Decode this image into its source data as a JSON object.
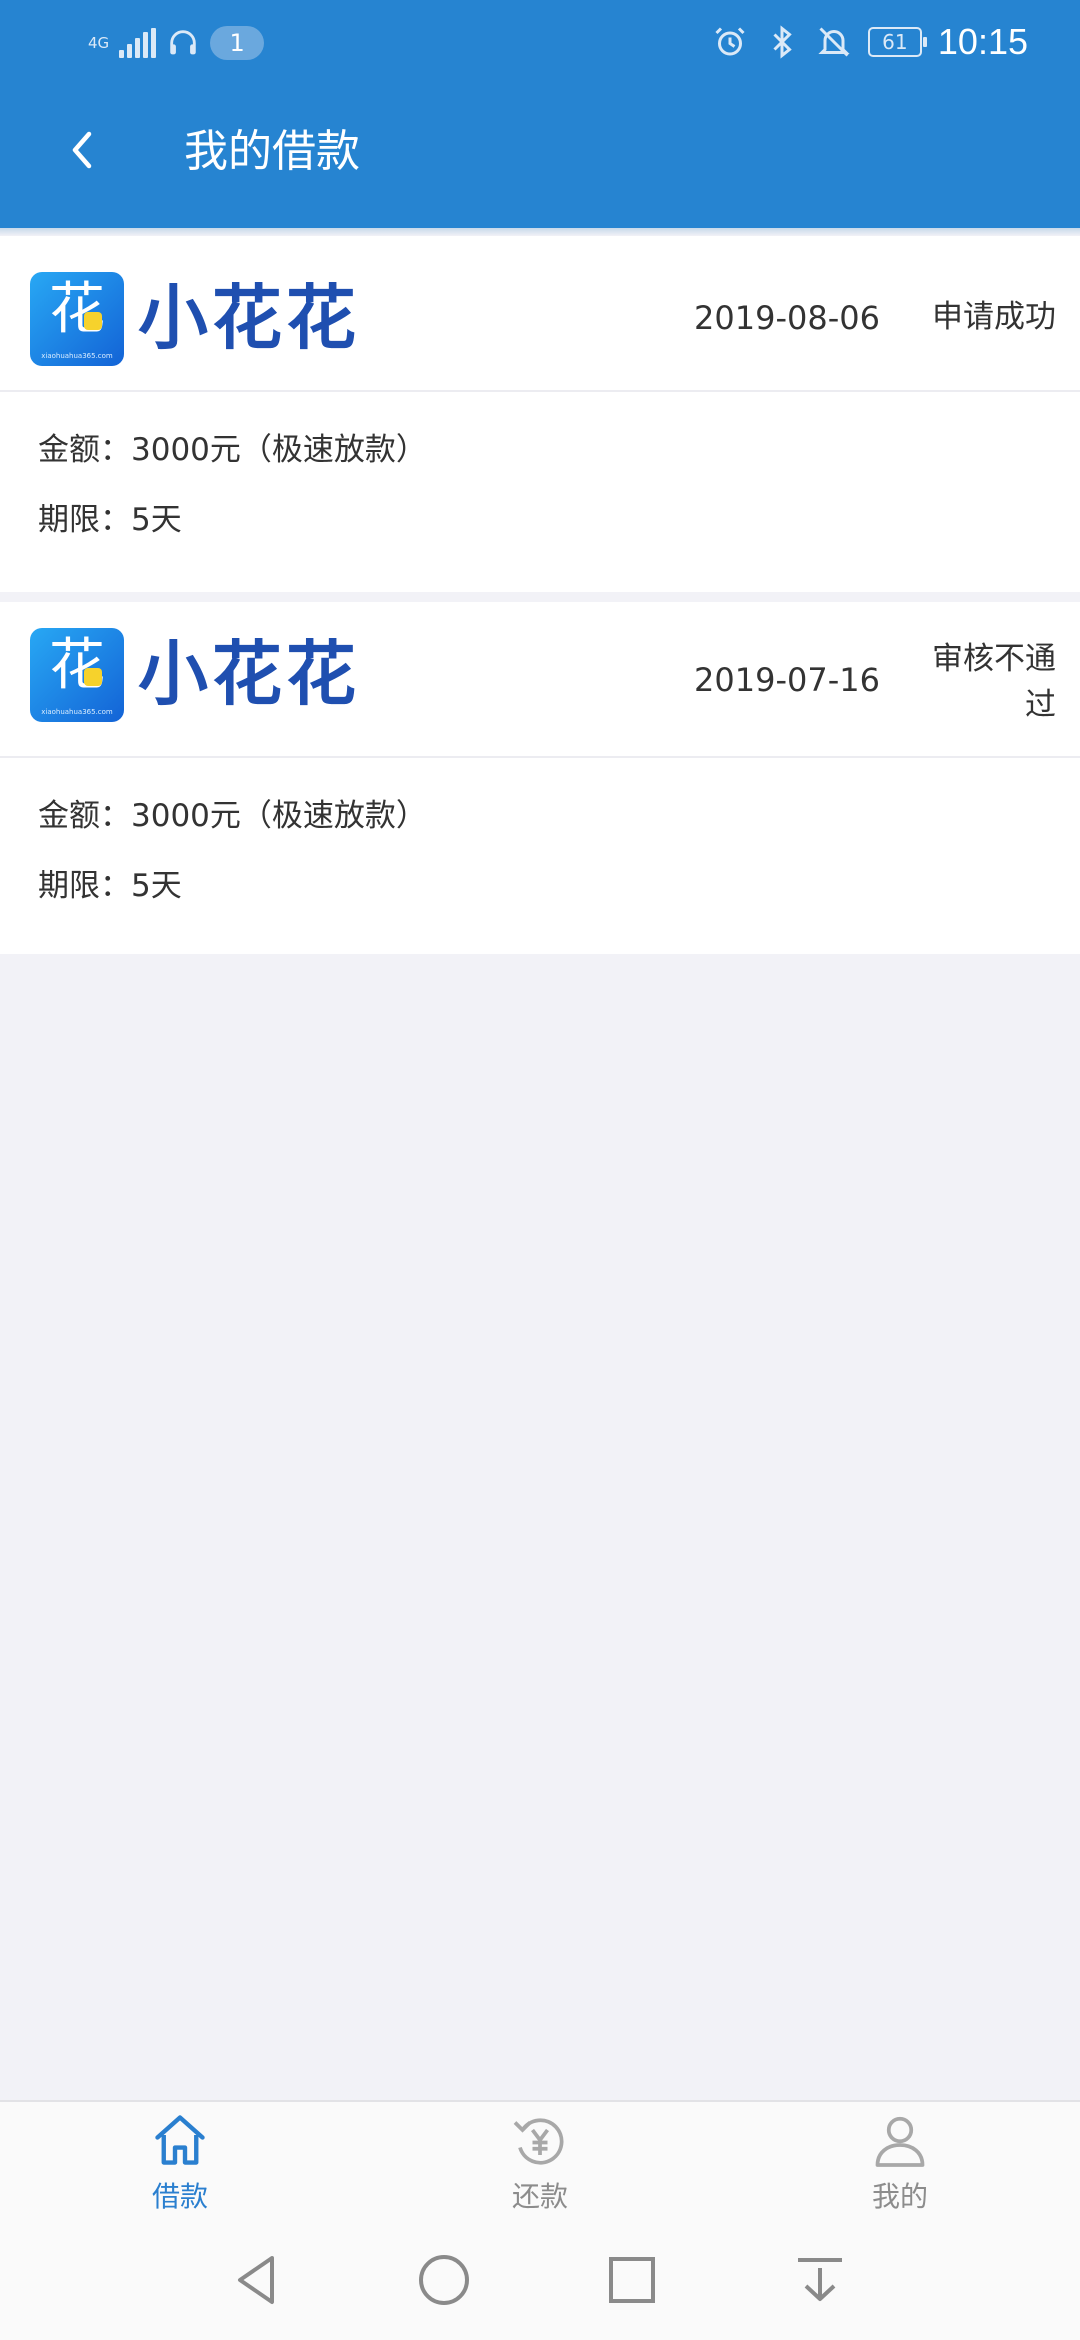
{
  "status_bar": {
    "network": "4G",
    "notification_count": "1",
    "battery": "61",
    "time": "10:15"
  },
  "header": {
    "title": "我的借款"
  },
  "loans": [
    {
      "brand": "小花花",
      "date": "2019-08-06",
      "status": "申请成功",
      "amount_label": "金额：",
      "amount": "3000元（极速放款）",
      "term_label": "期限：",
      "term": "5天"
    },
    {
      "brand": "小花花",
      "date": "2019-07-16",
      "status": "审核不通过",
      "amount_label": "金额：",
      "amount": "3000元（极速放款）",
      "term_label": "期限：",
      "term": "5天"
    }
  ],
  "tabs": [
    {
      "label": "借款",
      "icon": "home-icon",
      "active": true
    },
    {
      "label": "还款",
      "icon": "repay-icon",
      "active": false
    },
    {
      "label": "我的",
      "icon": "person-icon",
      "active": false
    }
  ],
  "colors": {
    "primary": "#2684d1",
    "brand": "#1f4fb0",
    "active_tab": "#2a7fcf",
    "inactive_tab": "#9a9a9a",
    "page_bg": "#f2f2f7"
  }
}
